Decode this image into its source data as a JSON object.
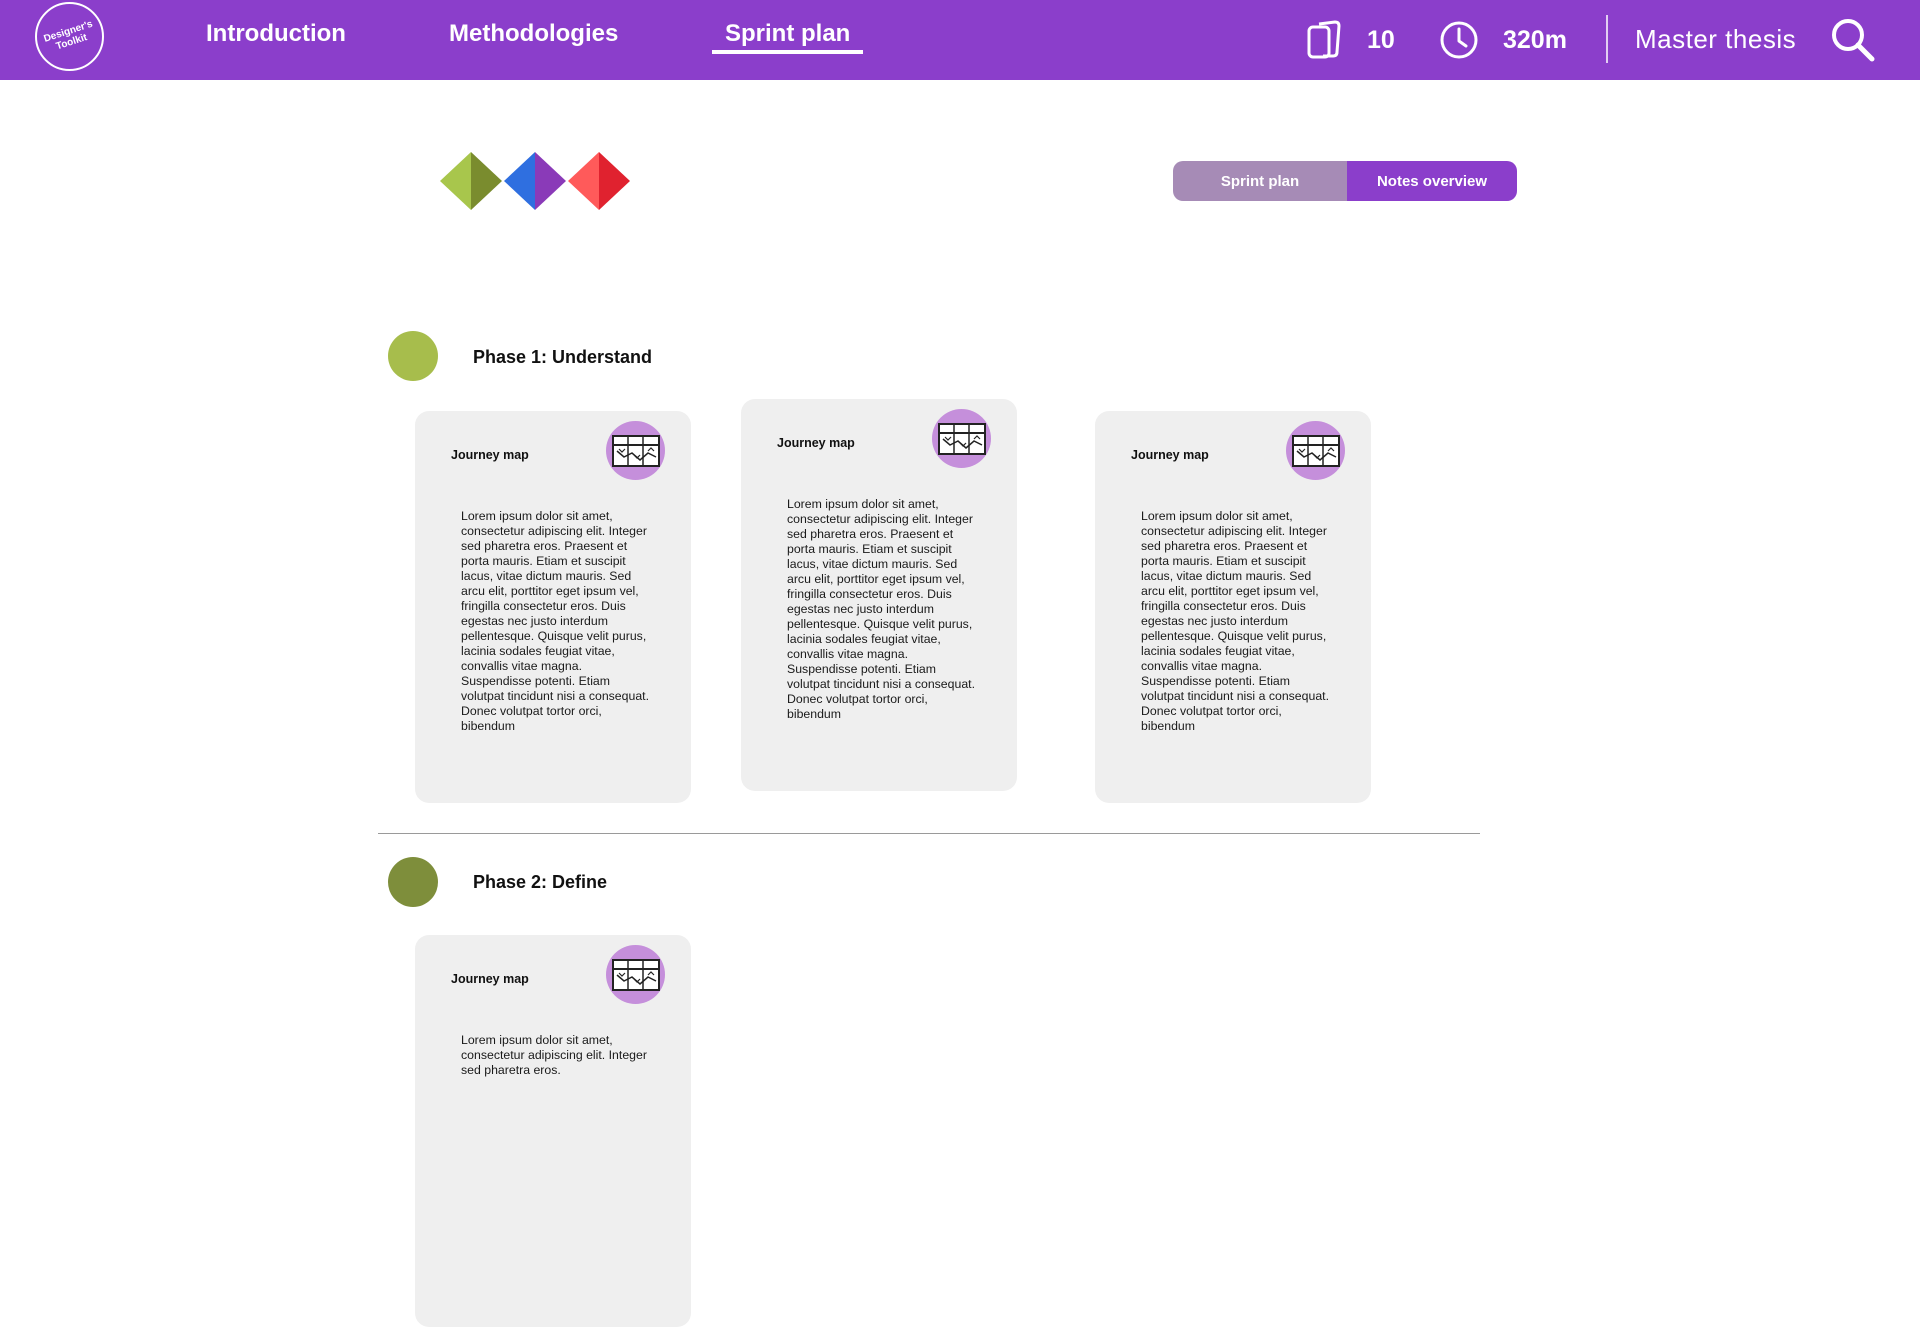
{
  "brand": {
    "logo_text": "Designer's Toolkit",
    "accent": "#8b3ecb"
  },
  "nav": {
    "items": [
      {
        "label": "Introduction",
        "active": false
      },
      {
        "label": "Methodologies",
        "active": false
      },
      {
        "label": "Sprint plan",
        "active": true
      }
    ]
  },
  "stats": {
    "cards": {
      "icon": "cards-icon",
      "value": "10"
    },
    "time": {
      "icon": "clock-icon",
      "value": "320m"
    }
  },
  "project": {
    "name": "Master thesis"
  },
  "search": {
    "icon": "search-icon"
  },
  "toggle": {
    "options": [
      {
        "label": "Sprint plan",
        "selected": false,
        "color": "#a68bb6"
      },
      {
        "label": "Notes overview",
        "selected": true,
        "color": "#8b3ecb"
      }
    ]
  },
  "diamond_colors": [
    "#a8c64c",
    "#7a8c2e",
    "#2f6fe0",
    "#8a3ab8",
    "#ff5a5a",
    "#e0222f"
  ],
  "phases": [
    {
      "title": "Phase 1: Understand",
      "color": "#a7bd4c",
      "cards": [
        {
          "title": "Journey map",
          "icon": "journey-map-icon",
          "body": "Lorem ipsum dolor sit amet, consectetur adipiscing elit. Integer sed pharetra eros. Praesent et porta mauris. Etiam et suscipit lacus, vitae dictum mauris. Sed arcu elit, porttitor eget ipsum vel, fringilla consectetur eros. Duis egestas nec justo interdum pellentesque. Quisque velit purus, lacinia sodales feugiat vitae, convallis vitae magna. Suspendisse potenti. Etiam volutpat tincidunt nisi a consequat. Donec volutpat tortor orci, bibendum"
        },
        {
          "title": "Journey map",
          "icon": "journey-map-icon",
          "body": "Lorem ipsum dolor sit amet, consectetur adipiscing elit. Integer sed pharetra eros. Praesent et porta mauris. Etiam et suscipit lacus, vitae dictum mauris. Sed arcu elit, porttitor eget ipsum vel, fringilla consectetur eros. Duis egestas nec justo interdum pellentesque. Quisque velit purus, lacinia sodales feugiat vitae, convallis vitae magna. Suspendisse potenti. Etiam volutpat tincidunt nisi a consequat. Donec volutpat tortor orci, bibendum"
        },
        {
          "title": "Journey map",
          "icon": "journey-map-icon",
          "body": "Lorem ipsum dolor sit amet, consectetur adipiscing elit. Integer sed pharetra eros. Praesent et porta mauris. Etiam et suscipit lacus, vitae dictum mauris. Sed arcu elit, porttitor eget ipsum vel, fringilla consectetur eros. Duis egestas nec justo interdum pellentesque. Quisque velit purus, lacinia sodales feugiat vitae, convallis vitae magna. Suspendisse potenti. Etiam volutpat tincidunt nisi a consequat. Donec volutpat tortor orci, bibendum"
        }
      ]
    },
    {
      "title": "Phase 2: Define",
      "color": "#7e8e3b",
      "cards": [
        {
          "title": "Journey map",
          "icon": "journey-map-icon",
          "body": "Lorem ipsum dolor sit amet, consectetur adipiscing elit. Integer sed pharetra eros."
        }
      ]
    }
  ]
}
